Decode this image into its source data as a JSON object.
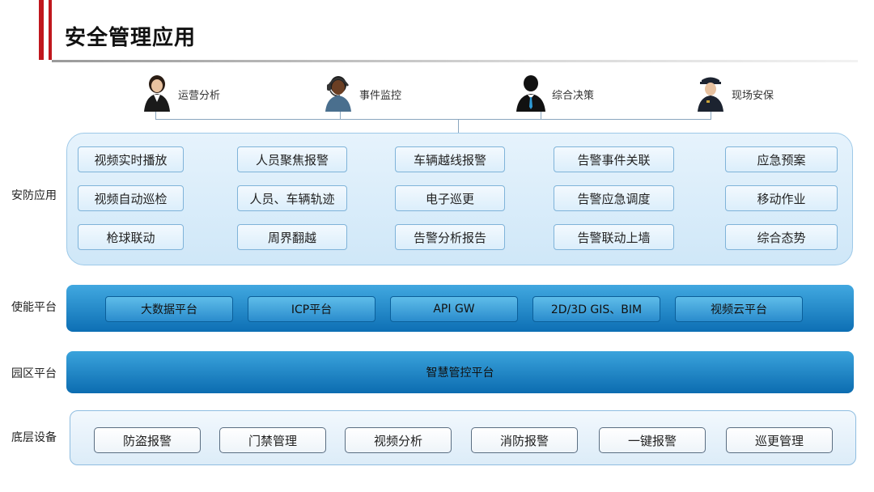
{
  "title": "安全管理应用",
  "roles": [
    {
      "label": "运营分析",
      "icon": "businesswoman-icon"
    },
    {
      "label": "事件监控",
      "icon": "headset-operator-icon"
    },
    {
      "label": "综合决策",
      "icon": "businessman-icon"
    },
    {
      "label": "现场安保",
      "icon": "security-guard-icon"
    }
  ],
  "rows": {
    "app": "安防应用",
    "enable": "使能平台",
    "park": "园区平台",
    "device": "底层设备"
  },
  "app_buttons": [
    [
      "视频实时播放",
      "人员聚焦报警",
      "车辆越线报警",
      "告警事件关联",
      "应急预案"
    ],
    [
      "视频自动巡检",
      "人员、车辆轨迹",
      "电子巡更",
      "告警应急调度",
      "移动作业"
    ],
    [
      "枪球联动",
      "周界翻越",
      "告警分析报告",
      "告警联动上墙",
      "综合态势"
    ]
  ],
  "enable_buttons": [
    "大数据平台",
    "ICP平台",
    "API GW",
    "2D/3D GIS、BIM",
    "视频云平台"
  ],
  "park_platform": "智慧管控平台",
  "device_buttons": [
    "防盗报警",
    "门禁管理",
    "视频分析",
    "消防报警",
    "一键报警",
    "巡更管理"
  ]
}
